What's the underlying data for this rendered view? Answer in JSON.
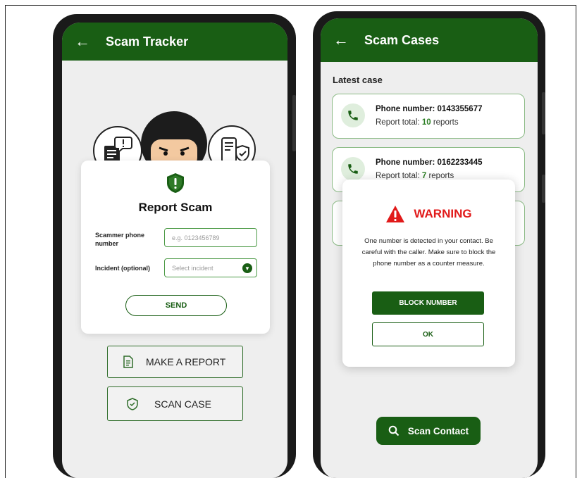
{
  "left_screen": {
    "appbar": {
      "back_icon": "arrow-left-icon",
      "title": "Scam Tracker"
    },
    "report_form": {
      "title": "Report Scam",
      "shield_icon": "shield-alert-icon",
      "phone_label": "Scammer phone number",
      "phone_placeholder": "e.g. 0123456789",
      "incident_label": "Incident (optional)",
      "incident_placeholder": "Select incident",
      "send_label": "SEND"
    },
    "buttons": {
      "make_report": "MAKE A REPORT",
      "scan_case": "SCAN CASE"
    }
  },
  "right_screen": {
    "appbar": {
      "back_icon": "arrow-left-icon",
      "title": "Scam Cases"
    },
    "section_title": "Latest case",
    "cases": [
      {
        "phone_label": "Phone number: 0143355677",
        "total_prefix": "Report total: ",
        "total_value": "10",
        "total_suffix": " reports"
      },
      {
        "phone_label": "Phone number: 0162233445",
        "total_prefix": "Report total: ",
        "total_value": "7",
        "total_suffix": " reports"
      }
    ],
    "warning": {
      "title": "WARNING",
      "message": "One number is detected in your contact. Be careful with the caller. Make sure to block the phone number as a counter measure.",
      "block_label": "BLOCK NUMBER",
      "ok_label": "OK"
    },
    "scan_contact_label": "Scan Contact"
  },
  "colors": {
    "primary": "#195e14",
    "warning": "#e11a1a",
    "accent_green": "#2a7d22"
  }
}
